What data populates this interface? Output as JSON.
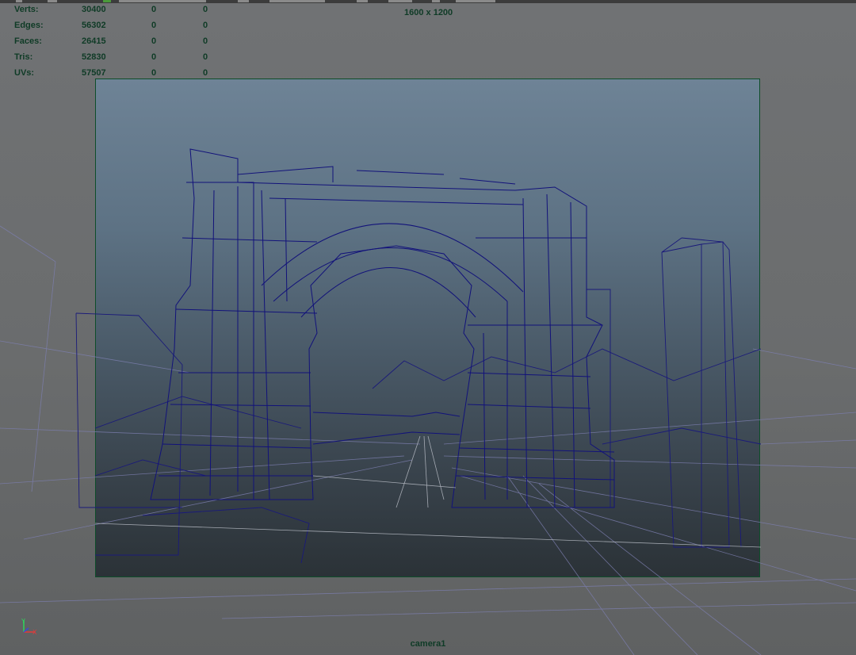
{
  "hud": {
    "rows": [
      {
        "label": "Verts:",
        "total": "30400",
        "selected": "0",
        "component": "0"
      },
      {
        "label": "Edges:",
        "total": "56302",
        "selected": "0",
        "component": "0"
      },
      {
        "label": "Faces:",
        "total": "26415",
        "selected": "0",
        "component": "0"
      },
      {
        "label": "Tris:",
        "total": "52830",
        "selected": "0",
        "component": "0"
      },
      {
        "label": "UVs:",
        "total": "57507",
        "selected": "0",
        "component": "0"
      }
    ]
  },
  "viewport": {
    "resolution": "1600 x 1200",
    "camera": "camera1"
  },
  "gizmo": {
    "axes": [
      "y-axis",
      "x-axis",
      "z-axis"
    ]
  },
  "colors": {
    "hud_text": "#0f3b26",
    "wireframe": "#1a1a7a",
    "gate_border": "#0e4d2a",
    "background": "#6b6d6e"
  }
}
